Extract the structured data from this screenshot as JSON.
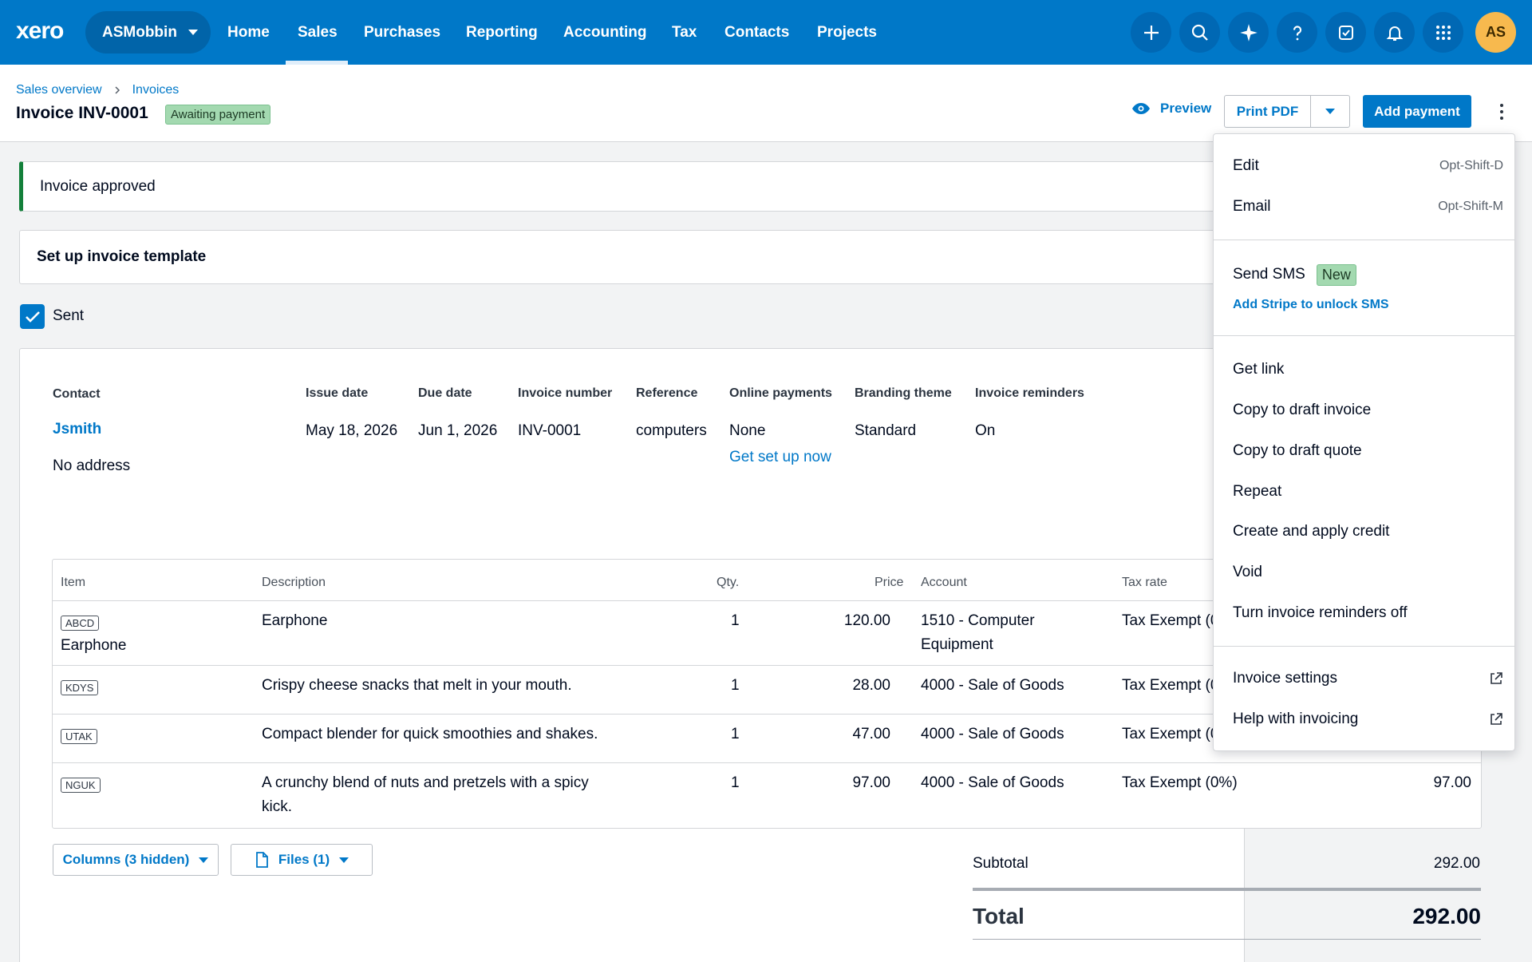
{
  "nav": {
    "logo": "xero",
    "org": "ASMobbin",
    "links": [
      "Home",
      "Sales",
      "Purchases",
      "Reporting",
      "Accounting",
      "Tax",
      "Contacts",
      "Projects"
    ],
    "active": "Sales",
    "icons": [
      "plus-icon",
      "search-icon",
      "sparkle-icon",
      "help-icon",
      "tasks-icon",
      "bell-icon",
      "apps-grid-icon"
    ],
    "avatar": "AS"
  },
  "breadcrumb": {
    "items": [
      "Sales overview",
      "Invoices"
    ]
  },
  "header": {
    "title": "Invoice INV-0001",
    "status": "Awaiting payment",
    "preview": "Preview",
    "print_pdf": "Print PDF",
    "add_payment": "Add payment"
  },
  "banner": {
    "approved": "Invoice approved",
    "template": "Set up invoice template"
  },
  "sent": {
    "label": "Sent",
    "checked": true
  },
  "invoice": {
    "contact_label": "Contact",
    "contact_name": "Jsmith",
    "address": "No address",
    "fields": [
      {
        "label": "Issue date",
        "value": "May 18, 2026"
      },
      {
        "label": "Due date",
        "value": "Jun 1, 2026"
      },
      {
        "label": "Invoice number",
        "value": "INV-0001"
      },
      {
        "label": "Reference",
        "value": "computers"
      },
      {
        "label": "Online payments",
        "value": "None",
        "link": "Get set up now"
      },
      {
        "label": "Branding theme",
        "value": "Standard"
      },
      {
        "label": "Invoice reminders",
        "value": "On"
      }
    ]
  },
  "table": {
    "headers": [
      "Item",
      "Description",
      "Qty.",
      "Price",
      "Account",
      "Tax rate"
    ],
    "rows": [
      {
        "code": "ABCD",
        "item": "Earphone",
        "description": "Earphone",
        "qty": "1",
        "price": "120.00",
        "account_1": "1510 - Computer",
        "account_2": "Equipment",
        "tax": "Tax Exempt (0",
        "amount": ""
      },
      {
        "code": "KDYS",
        "item": "",
        "description": "Crispy cheese snacks that melt in your mouth.",
        "qty": "1",
        "price": "28.00",
        "account_1": "4000 - Sale of Goods",
        "account_2": "",
        "tax": "Tax Exempt (0",
        "amount": ""
      },
      {
        "code": "UTAK",
        "item": "",
        "description": "Compact blender for quick smoothies and shakes.",
        "qty": "1",
        "price": "47.00",
        "account_1": "4000 - Sale of Goods",
        "account_2": "",
        "tax": "Tax Exempt (0",
        "amount": ""
      },
      {
        "code": "NGUK",
        "item": "",
        "description": "A crunchy blend of nuts and pretzels with a spicy",
        "description_2": "kick.",
        "qty": "1",
        "price": "97.00",
        "account_1": "4000 - Sale of Goods",
        "account_2": "",
        "tax": "Tax Exempt (0%)",
        "amount": "97.00"
      }
    ]
  },
  "footer_buttons": {
    "columns": "Columns (3 hidden)",
    "files": "Files (1)"
  },
  "totals": {
    "subtotal_label": "Subtotal",
    "subtotal": "292.00",
    "total_label": "Total",
    "total": "292.00"
  },
  "menu": {
    "edit": "Edit",
    "edit_shortcut": "Opt-Shift-D",
    "email": "Email",
    "email_shortcut": "Opt-Shift-M",
    "send_sms": "Send SMS",
    "new_badge": "New",
    "stripe_link": "Add Stripe to unlock SMS",
    "get_link": "Get link",
    "copy_invoice": "Copy to draft invoice",
    "copy_quote": "Copy to draft quote",
    "repeat": "Repeat",
    "credit": "Create and apply credit",
    "void": "Void",
    "reminders_off": "Turn invoice reminders off",
    "settings": "Invoice settings",
    "help": "Help with invoicing"
  },
  "colors": {
    "brand": "#0078c8",
    "success": "#13803a",
    "badge_green": "#a3d9b0",
    "avatar": "#f7b94e"
  }
}
